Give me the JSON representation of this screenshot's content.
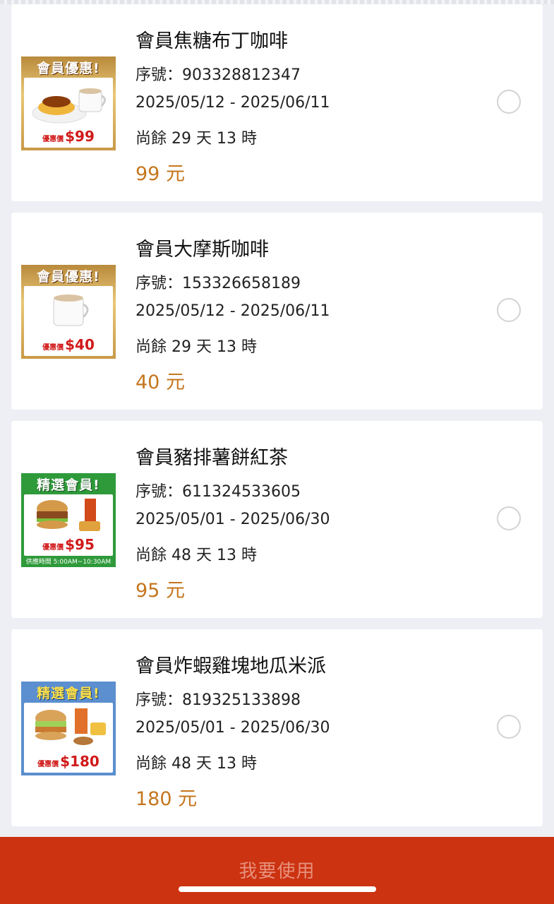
{
  "coupons": [
    {
      "title": "會員焦糖布丁咖啡",
      "serial": "序號：903328812347",
      "dates": "2025/05/12 - 2025/06/11",
      "remaining": "尚餘 29 天 13 時",
      "amount": "99 元",
      "image": {
        "banner": "會員優惠!",
        "price_label": "優惠價",
        "price": "$99",
        "theme": "gold"
      }
    },
    {
      "title": "會員大摩斯咖啡",
      "serial": "序號：153326658189",
      "dates": "2025/05/12 - 2025/06/11",
      "remaining": "尚餘 29 天 13 時",
      "amount": "40 元",
      "image": {
        "banner": "會員優惠!",
        "price_label": "優惠價",
        "price": "$40",
        "theme": "gold"
      }
    },
    {
      "title": "會員豬排薯餅紅茶",
      "serial": "序號：611324533605",
      "dates": "2025/05/01 - 2025/06/30",
      "remaining": "尚餘 48 天 13 時",
      "amount": "95 元",
      "image": {
        "banner": "精選會員!",
        "price_label": "優惠價",
        "price": "$95",
        "footnote": "供應時間 5:00AM~10:30AM",
        "theme": "green"
      }
    },
    {
      "title": "會員炸蝦雞塊地瓜米派",
      "serial": "序號：819325133898",
      "dates": "2025/05/01 - 2025/06/30",
      "remaining": "尚餘 48 天 13 時",
      "amount": "180 元",
      "image": {
        "banner": "精選會員!",
        "price_label": "優惠價",
        "price": "$180",
        "theme": "blue"
      }
    }
  ],
  "use_button": "我要使用",
  "colors": {
    "amount": "#c4761e",
    "bottom_bar": "#cc3311",
    "background": "#eeeff5"
  }
}
